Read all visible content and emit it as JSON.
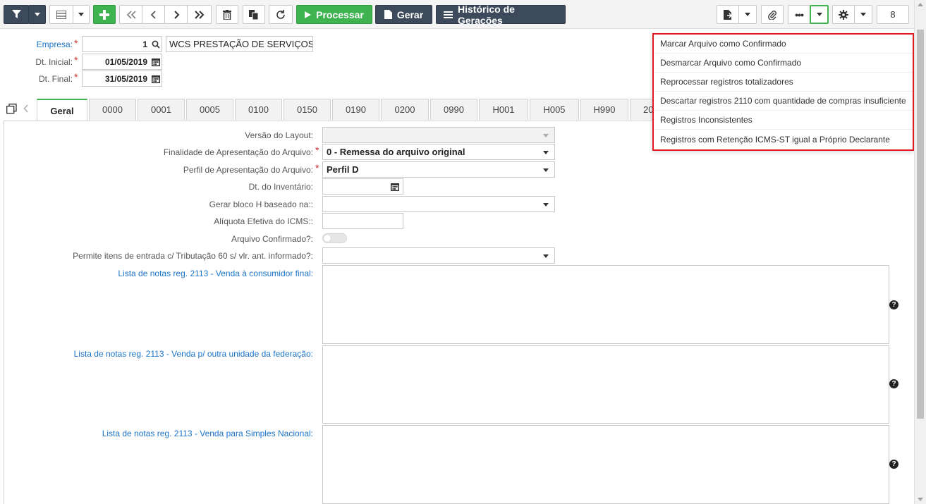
{
  "toolbar": {
    "processar_label": "Processar",
    "gerar_label": "Gerar",
    "historico_label": "Histórico de Gerações",
    "page_count": "8"
  },
  "header": {
    "empresa_label": "Empresa:",
    "empresa_code": "1",
    "empresa_name": "WCS PRESTAÇÃO DE SERVIÇOS",
    "dt_inicial_label": "Dt. Inicial:",
    "dt_inicial_value": "01/05/2019",
    "dt_final_label": "Dt. Final:",
    "dt_final_value": "31/05/2019"
  },
  "tabs": [
    "Geral",
    "0000",
    "0001",
    "0005",
    "0100",
    "0150",
    "0190",
    "0200",
    "0990",
    "H001",
    "H005",
    "H990",
    "20"
  ],
  "form": {
    "versao_label": "Versão do Layout:",
    "versao_value": "",
    "finalidade_label": "Finalidade de Apresentação do Arquivo:",
    "finalidade_value": "0 - Remessa do arquivo original",
    "perfil_label": "Perfil de Apresentação do Arquivo:",
    "perfil_value": "Perfil D",
    "dt_inventario_label": "Dt. do Inventário:",
    "bloco_h_label": "Gerar bloco H baseado na::",
    "aliquota_label": "Alíquota Efetiva do ICMS::",
    "arquivo_confirmado_label": "Arquivo Confirmado?:",
    "permite_itens_label": "Permite itens de entrada c/ Tributação 60 s/ vlr. ant. informado?:",
    "lista_consumidor_label": "Lista de notas reg. 2113 - Venda à consumidor final:",
    "lista_outra_uf_label": "Lista de notas reg. 2113 - Venda p/ outra unidade da federação:",
    "lista_simples_label": "Lista de notas reg. 2113 - Venda para Simples Nacional:"
  },
  "menu": {
    "items": [
      "Marcar Arquivo como Confirmado",
      "Desmarcar Arquivo como Confirmado",
      "Reprocessar registros totalizadores",
      "Descartar registros 2110 com quantidade de compras insuficiente",
      "Registros Inconsistentes",
      "Registros com Retenção ICMS-ST igual a Próprio Declarante"
    ]
  },
  "colors": {
    "accent_green": "#3fb34f",
    "dark_button": "#3d4a5c",
    "highlight_red": "#e21b23",
    "link_blue": "#1a73c8"
  }
}
